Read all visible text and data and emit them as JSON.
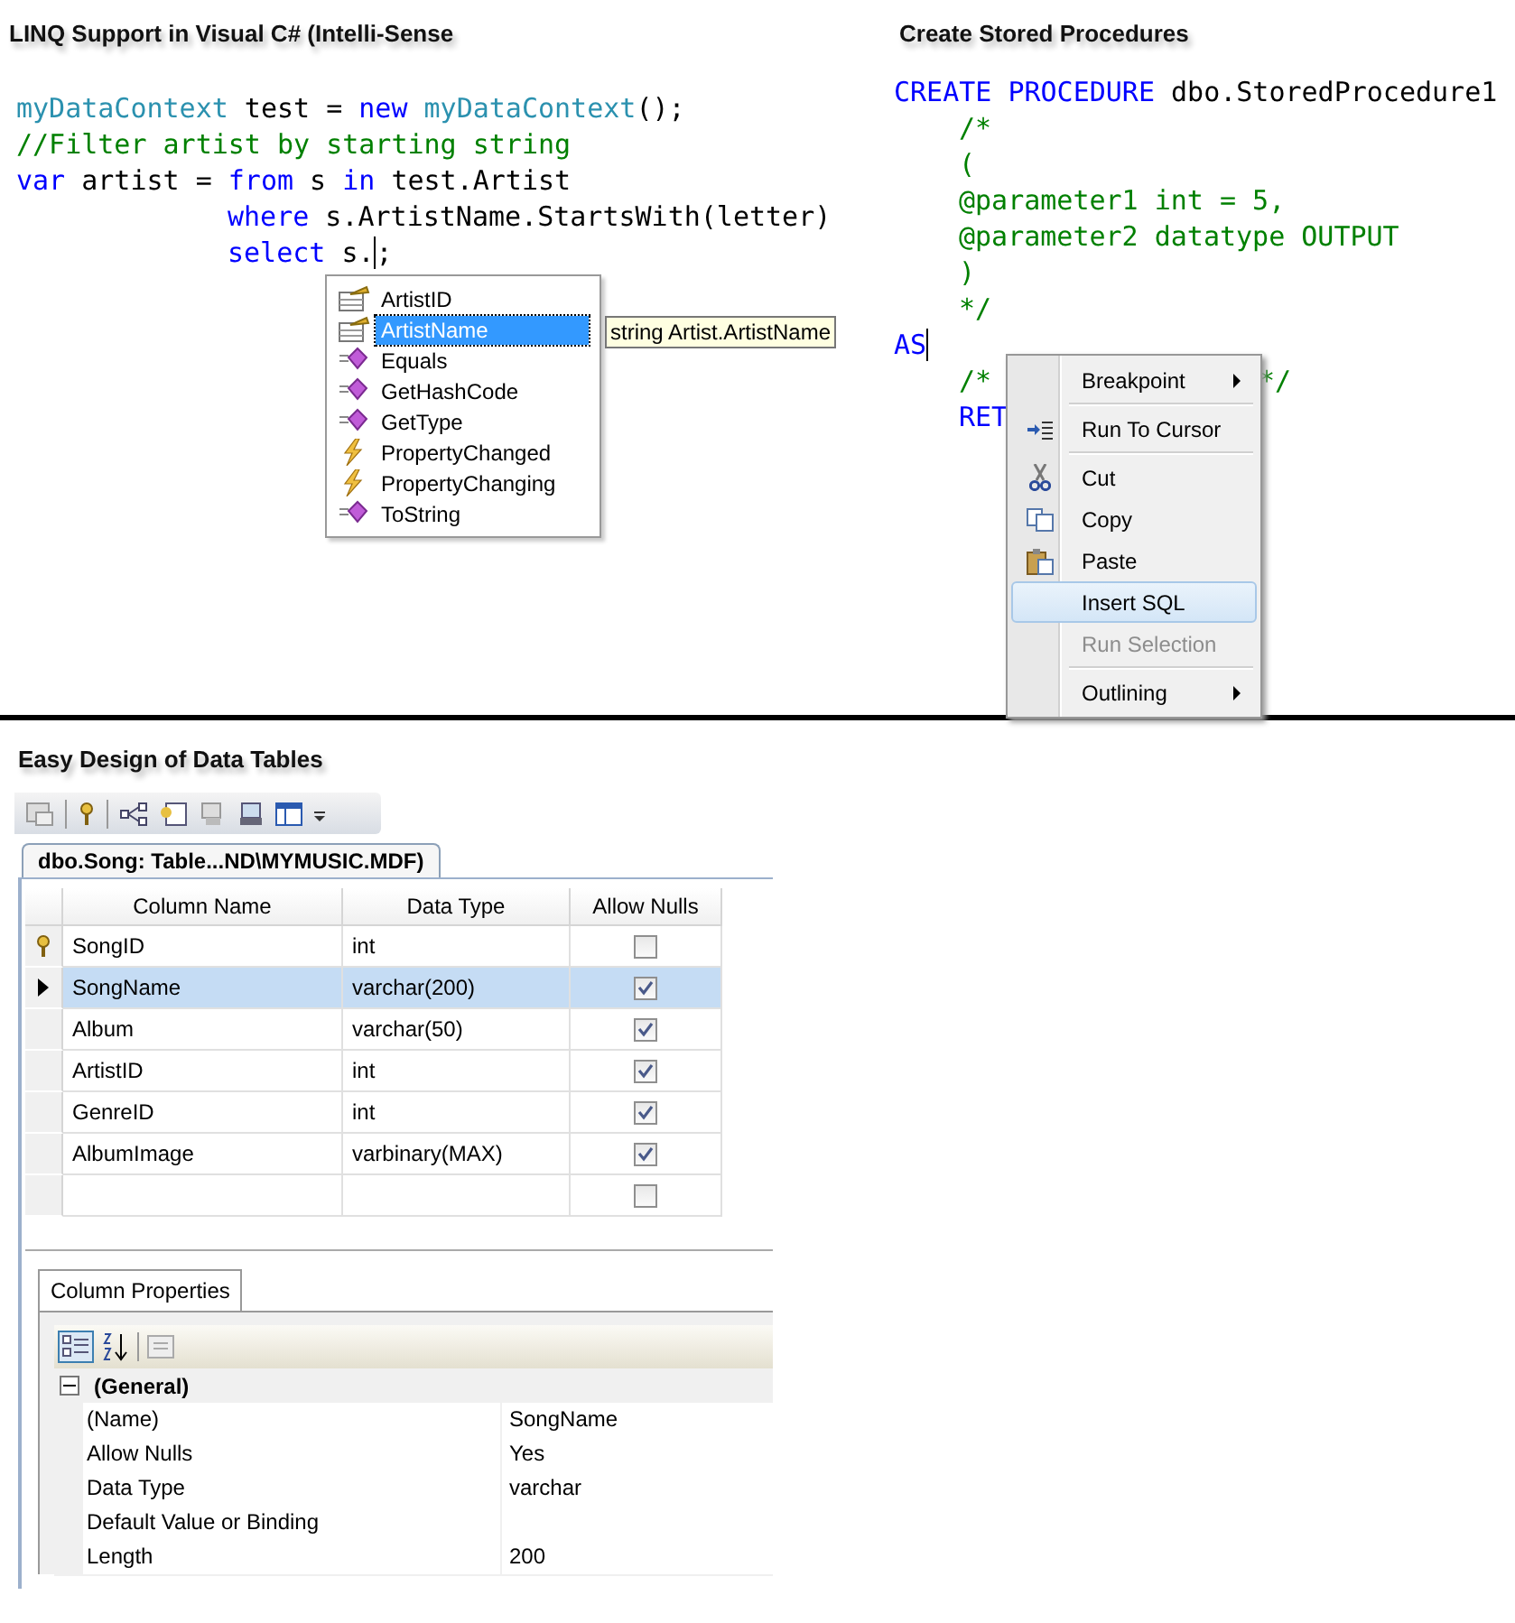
{
  "linq": {
    "title": "LINQ Support in Visual C# (Intelli-Sense",
    "code": [
      {
        "indented": false,
        "tokens": [
          {
            "kind": "type",
            "text": "myDataContext"
          },
          {
            "kind": "plain",
            "text": " test = "
          },
          {
            "kind": "keyword",
            "text": "new"
          },
          {
            "kind": "type",
            "text": " myDataContext"
          },
          {
            "kind": "plain",
            "text": "();"
          }
        ]
      },
      {
        "indented": false,
        "tokens": [
          {
            "kind": "comment",
            "text": "//Filter artist by starting string"
          }
        ]
      },
      {
        "indented": false,
        "tokens": [
          {
            "kind": "keyword",
            "text": "var"
          },
          {
            "kind": "plain",
            "text": " artist = "
          },
          {
            "kind": "keyword",
            "text": "from"
          },
          {
            "kind": "plain",
            "text": " s "
          },
          {
            "kind": "keyword",
            "text": "in"
          },
          {
            "kind": "plain",
            "text": " test.Artist"
          }
        ]
      },
      {
        "indented": true,
        "tokens": [
          {
            "kind": "keyword",
            "text": "where"
          },
          {
            "kind": "plain",
            "text": " s.ArtistName.StartsWith(letter)"
          }
        ]
      },
      {
        "indented": true,
        "tokens": [
          {
            "kind": "keyword",
            "text": "select"
          },
          {
            "kind": "plain",
            "text": " s."
          },
          {
            "kind": "caret"
          },
          {
            "kind": "plain",
            "text": ";"
          }
        ]
      }
    ],
    "completion": {
      "items": [
        {
          "label": "ArtistID",
          "kind": "property",
          "selected": false
        },
        {
          "label": "ArtistName",
          "kind": "property",
          "selected": true
        },
        {
          "label": "Equals",
          "kind": "method",
          "selected": false
        },
        {
          "label": "GetHashCode",
          "kind": "method",
          "selected": false
        },
        {
          "label": "GetType",
          "kind": "method",
          "selected": false
        },
        {
          "label": "PropertyChanged",
          "kind": "event",
          "selected": false
        },
        {
          "label": "PropertyChanging",
          "kind": "event",
          "selected": false
        },
        {
          "label": "ToString",
          "kind": "method",
          "selected": false
        }
      ],
      "tooltip": "string Artist.ArtistName"
    }
  },
  "stored_procedure": {
    "title": "Create Stored Procedures",
    "code": [
      {
        "indented": false,
        "covered": false,
        "tokens": [
          {
            "kind": "keyword",
            "text": "CREATE PROCEDURE"
          },
          {
            "kind": "plain",
            "text": " dbo.StoredProcedure1"
          }
        ]
      },
      {
        "indented": true,
        "covered": false,
        "tokens": [
          {
            "kind": "comment",
            "text": "/*"
          }
        ]
      },
      {
        "indented": true,
        "covered": false,
        "tokens": [
          {
            "kind": "comment",
            "text": "("
          }
        ]
      },
      {
        "indented": true,
        "covered": false,
        "tokens": [
          {
            "kind": "comment",
            "text": "@parameter1 int = 5,"
          }
        ]
      },
      {
        "indented": true,
        "covered": false,
        "tokens": [
          {
            "kind": "comment",
            "text": "@parameter2 datatype OUTPUT"
          }
        ]
      },
      {
        "indented": true,
        "covered": false,
        "tokens": [
          {
            "kind": "comment",
            "text": ")"
          }
        ]
      },
      {
        "indented": true,
        "covered": false,
        "tokens": [
          {
            "kind": "comment",
            "text": "*/"
          }
        ]
      },
      {
        "indented": false,
        "covered": false,
        "tokens": [
          {
            "kind": "keyword",
            "text": "AS"
          },
          {
            "kind": "caret"
          }
        ]
      },
      {
        "indented": true,
        "covered": true,
        "tokens": [
          {
            "kind": "comment",
            "text": "/*"
          },
          {
            "kind": "comment",
            "text": "*/"
          }
        ]
      },
      {
        "indented": true,
        "covered": false,
        "tokens": [
          {
            "kind": "keyword",
            "text": "RET"
          }
        ]
      }
    ],
    "context_menu": {
      "items": [
        {
          "kind": "item",
          "label": "Breakpoint",
          "submenu": true,
          "selected": false,
          "disabled": false
        },
        {
          "kind": "separator"
        },
        {
          "kind": "item",
          "label": "Run To Cursor",
          "submenu": false,
          "selected": false,
          "disabled": false
        },
        {
          "kind": "separator"
        },
        {
          "kind": "item",
          "label": "Cut",
          "submenu": false,
          "selected": false,
          "disabled": false
        },
        {
          "kind": "item",
          "label": "Copy",
          "submenu": false,
          "selected": false,
          "disabled": false
        },
        {
          "kind": "item",
          "label": "Paste",
          "submenu": false,
          "selected": false,
          "disabled": false
        },
        {
          "kind": "item",
          "label": "Insert SQL",
          "submenu": false,
          "selected": true,
          "disabled": false
        },
        {
          "kind": "item",
          "label": "Run Selection",
          "submenu": false,
          "selected": false,
          "disabled": true
        },
        {
          "kind": "separator"
        },
        {
          "kind": "item",
          "label": "Outlining",
          "submenu": true,
          "selected": false,
          "disabled": false
        }
      ]
    }
  },
  "table_designer": {
    "title": "Easy Design of Data Tables",
    "tab": "dbo.Song: Table...ND\\MYMUSIC.MDF)",
    "columns": [
      "Column Name",
      "Data Type",
      "Allow Nulls"
    ],
    "rows": [
      {
        "name": "SongID",
        "type": "int",
        "allow_nulls": false,
        "primary_key": true,
        "selected": false
      },
      {
        "name": "SongName",
        "type": "varchar(200)",
        "allow_nulls": true,
        "primary_key": false,
        "selected": true
      },
      {
        "name": "Album",
        "type": "varchar(50)",
        "allow_nulls": true,
        "primary_key": false,
        "selected": false
      },
      {
        "name": "ArtistID",
        "type": "int",
        "allow_nulls": true,
        "primary_key": false,
        "selected": false
      },
      {
        "name": "GenreID",
        "type": "int",
        "allow_nulls": true,
        "primary_key": false,
        "selected": false
      },
      {
        "name": "AlbumImage",
        "type": "varbinary(MAX)",
        "allow_nulls": true,
        "primary_key": false,
        "selected": false
      },
      {
        "allow_nulls": false,
        "primary_key": false,
        "selected": false
      }
    ],
    "properties": {
      "tab": "Column Properties",
      "category": "(General)",
      "expanded": true,
      "rows": [
        {
          "name": "(Name)",
          "value": "SongName"
        },
        {
          "name": "Allow Nulls",
          "value": "Yes"
        },
        {
          "name": "Data Type",
          "value": "varchar"
        },
        {
          "name": "Default Value or Binding"
        },
        {
          "name": "Length",
          "value": "200"
        }
      ]
    }
  }
}
